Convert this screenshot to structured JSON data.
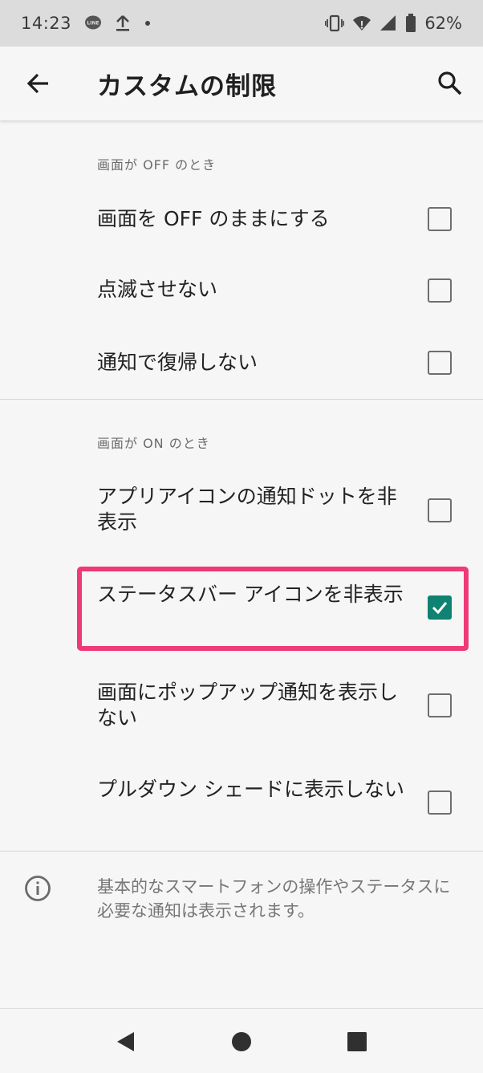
{
  "status_bar": {
    "time": "14:23",
    "battery": "62%",
    "icons": [
      "line-app-icon",
      "upload-icon",
      "dot-icon",
      "vibrate-icon",
      "wifi-icon",
      "signal-icon",
      "battery-icon"
    ]
  },
  "app_bar": {
    "title": "カスタムの制限",
    "back_icon": "arrow-left-icon",
    "search_icon": "search-icon"
  },
  "sections": [
    {
      "header": "画面が OFF のとき",
      "items": [
        {
          "label": "画面を OFF のままにする",
          "checked": false
        },
        {
          "label": "点滅させない",
          "checked": false
        },
        {
          "label": "通知で復帰しない",
          "checked": false
        }
      ]
    },
    {
      "header": "画面が ON のとき",
      "items": [
        {
          "label": "アプリアイコンの通知ドットを非表示",
          "checked": false
        },
        {
          "label": "ステータスバー アイコンを非表示",
          "checked": true
        },
        {
          "label": "画面にポップアップ通知を表示しない",
          "checked": false
        },
        {
          "label": "プルダウン シェードに表示しない",
          "checked": false
        }
      ]
    }
  ],
  "footer_info": "基本的なスマートフォンの操作やステータスに必要な通知は表示されます。",
  "accent_color": "#0f8272",
  "highlight_color": "#ee3a75",
  "nav_bar": {
    "icons": [
      "back-triangle-icon",
      "home-circle-icon",
      "recents-square-icon"
    ]
  }
}
